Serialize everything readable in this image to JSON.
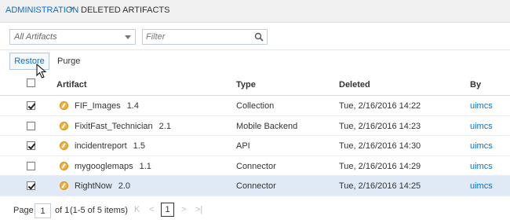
{
  "breadcrumb": {
    "parent": "ADMINISTRATION",
    "separator": ">",
    "current": "DELETED ARTIFACTS"
  },
  "filters": {
    "type_select": {
      "value": "All Artifacts"
    },
    "search": {
      "placeholder": "Filter",
      "value": ""
    }
  },
  "toolbar": {
    "restore_label": "Restore",
    "purge_label": "Purge"
  },
  "table": {
    "columns": [
      "Artifact",
      "Type",
      "Deleted",
      "By"
    ],
    "rows": [
      {
        "checked": true,
        "name": "FIF_Images",
        "version": "1.4",
        "type": "Collection",
        "deleted": "Tue, 2/16/2016 14:22",
        "by": "uimcs",
        "selected": false
      },
      {
        "checked": false,
        "name": "FixitFast_Technician",
        "version": "2.1",
        "type": "Mobile Backend",
        "deleted": "Tue, 2/16/2016 14:23",
        "by": "uimcs",
        "selected": false
      },
      {
        "checked": true,
        "name": "incidentreport",
        "version": "1.5",
        "type": "API",
        "deleted": "Tue, 2/16/2016 14:30",
        "by": "uimcs",
        "selected": false
      },
      {
        "checked": false,
        "name": "mygooglemaps",
        "version": "1.1",
        "type": "Connector",
        "deleted": "Tue, 2/16/2016 14:29",
        "by": "uimcs",
        "selected": false
      },
      {
        "checked": true,
        "name": "RightNow",
        "version": "2.0",
        "type": "Connector",
        "deleted": "Tue, 2/16/2016 14:25",
        "by": "uimcs",
        "selected": true
      }
    ]
  },
  "pager": {
    "page_label": "Page",
    "page_value": "1",
    "of_label": "of 1",
    "items_info": "(1-5 of 5 items)",
    "current_page": "1",
    "first_glyph": "K",
    "prev_glyph": "<",
    "next_glyph": ">",
    "last_glyph": ">|"
  },
  "colors": {
    "link": "#0572ce",
    "selected_row": "#dfeaf6",
    "artifact_icon": "#f0ae3a"
  }
}
